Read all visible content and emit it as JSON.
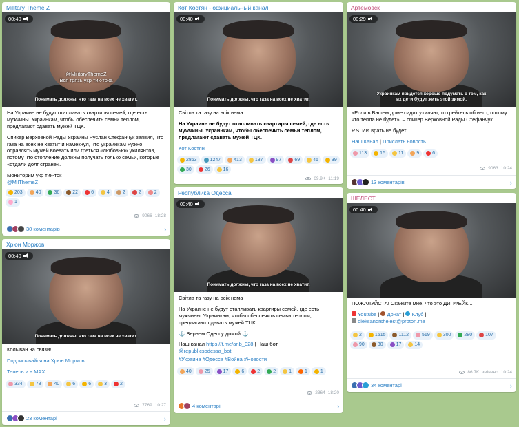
{
  "colors": {
    "page_bg": "#a9c98e",
    "link": "#2a7fc4",
    "reaction_bg": "#e8f1fa"
  },
  "posts": {
    "p1": {
      "channel": "Military Theme Z",
      "duration": "00:40",
      "watermark_handle": "@MilitaryThemeZ",
      "watermark_text": "Вся грязь укр тик-тока",
      "caption": "Понимать должны, что газа на всех не хватит.",
      "para1": "На Украине не будут отапливать квартиры семей, где есть мужчины. Украинкам, чтобы обеспечить семьи теплом, предлагают сдавать мужей ТЦК.",
      "para2": "Спикер Верховной Рады Украины Руслан Стефанчук заявил, что газа на всех не хватит и намекнул, что украинкам нужно оправлять мужей воевать или греться «любовью» ухилянтов, потому что отопление должны получать только семьи, которые «отдали долг стране».",
      "para3": "Мониторим укр тик-ток",
      "handle": "@MilThemeZ",
      "reactions": [
        "203",
        "40",
        "36",
        "22",
        "6",
        "4",
        "2",
        "2",
        "2",
        "1"
      ],
      "views": "9066",
      "time": "18:28",
      "comments": "30 коментарів"
    },
    "p2": {
      "channel": "Кот Костян - официальный канал",
      "duration": "00:40",
      "caption": "Понимать должны, что газа на всех не хватит.",
      "lead": "Світла та газу на всіх нема",
      "bold": "На Украине не будут отапливать квартиры семей, где есть мужчины. Украинкам, чтобы обеспечить семьи теплом, предлагают сдавать мужей ТЦК.",
      "signature_a": "Кот",
      "signature_b": "Костян",
      "reactions": [
        "2863",
        "1247",
        "413",
        "137",
        "97",
        "69",
        "46",
        "39",
        "30",
        "26",
        "16"
      ],
      "views": "69.9K",
      "time": "11:19"
    },
    "p3": {
      "channel": "Артёмовск",
      "duration": "00:29",
      "caption": "Украинкам придется хорошо подумать о том, как их дети будут жить этой зимой.",
      "para1": "«Если в Вашем доме сидит ухилянт, то грейтесь об него, потому что тепла не будет», – спикер Верховной Рады Стефанчук.",
      "para2": "P.S. ИИ врать не будет.",
      "link1": "Наш Канал",
      "sep": "|",
      "link2": "Прислать новость",
      "reactions": [
        "113",
        "15",
        "11",
        "9",
        "6"
      ],
      "views": "9063",
      "time": "10:24",
      "comments": "13 коментарів"
    },
    "p4": {
      "channel": "Хрюн Моржов",
      "duration": "00:40",
      "caption": "Понимать должны, что газа на всех не хватит.",
      "para1": "Колыван на связи!",
      "link1": "Подписывайся на Хрюн Моржов",
      "link2": "Теперь и в MAX",
      "reactions": [
        "334",
        "78",
        "40",
        "6",
        "6",
        "3",
        "2"
      ],
      "views": "7769",
      "time": "10:27",
      "comments": "23 коментарі"
    },
    "p5": {
      "channel": "Республика Одесса",
      "duration": "00:40",
      "caption": "Понимать должны, что газа на всех не хватит.",
      "lead": "Світла та газу на всіх нема",
      "para1": "На Украине не будут отапливать квартиры семей, где есть мужчины. Украинкам, чтобы обеспечить семьи теплом, предлагают сдавать мужей ТЦК.",
      "para2": "⚓ Вернем Одессу домой ⚓",
      "channel_prefix": "Наш канал ",
      "channel_link": "https://t.me/anb_028",
      "bot_prefix": " | Наш бот",
      "bot_link": "@republicsodessa_bot",
      "hashtags": "#Украина #Одесса #Война #Новости",
      "reactions": [
        "40",
        "25",
        "17",
        "6",
        "2",
        "2",
        "1",
        "1",
        "1"
      ],
      "views": "2364",
      "time": "18:20",
      "comments": "4 коментарі"
    },
    "p6": {
      "channel": "ШЕЛЕСТ",
      "duration": "00:40",
      "para1": "ПОЖАЛУЙСТА! Скажите мне, что это ДИПФЕЙК...",
      "yt": "Youtube",
      "donate": "Донат",
      "club": "Клуб",
      "email": "oleksandrshelest@proton.me",
      "reactions": [
        "2",
        "1515",
        "1112",
        "519",
        "300",
        "280",
        "107",
        "90",
        "30",
        "17",
        "14"
      ],
      "views": "86.7K",
      "edited": "змінено",
      "time": "10:24",
      "comments": "34 коментарі"
    }
  }
}
